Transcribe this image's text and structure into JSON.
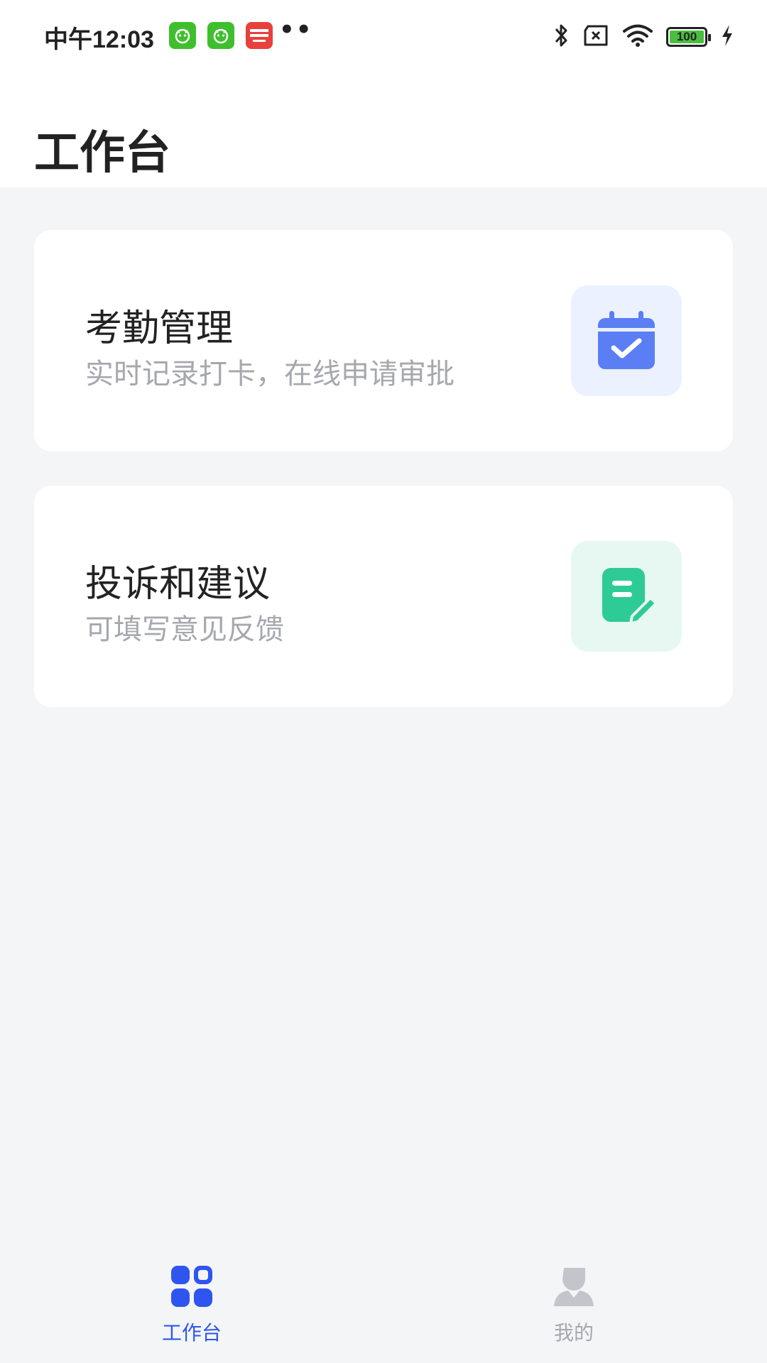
{
  "status_bar": {
    "time": "中午12:03",
    "battery_level": "100",
    "icons": [
      "app-notification-icon",
      "app-notification-icon",
      "news-app-icon",
      "more-dots",
      "bluetooth-icon",
      "sim-off-icon",
      "wifi-icon",
      "battery-icon",
      "charging-icon"
    ],
    "more_dots": "••"
  },
  "header": {
    "title": "工作台"
  },
  "cards": [
    {
      "title": "考勤管理",
      "subtitle": "实时记录打卡，在线申请审批",
      "icon": "calendar-check-icon",
      "icon_bg": "#ebf1fe",
      "icon_color": "#5b7ef4"
    },
    {
      "title": "投诉和建议",
      "subtitle": "可填写意见反馈",
      "icon": "document-edit-icon",
      "icon_bg": "#e6f8f1",
      "icon_color": "#2ecb97"
    }
  ],
  "tabbar": {
    "tabs": [
      {
        "label": "工作台",
        "icon": "grid-apps-icon",
        "active": true
      },
      {
        "label": "我的",
        "icon": "person-icon",
        "active": false
      }
    ],
    "active_color": "#2e55f0",
    "inactive_color": "#a6a8ad"
  }
}
